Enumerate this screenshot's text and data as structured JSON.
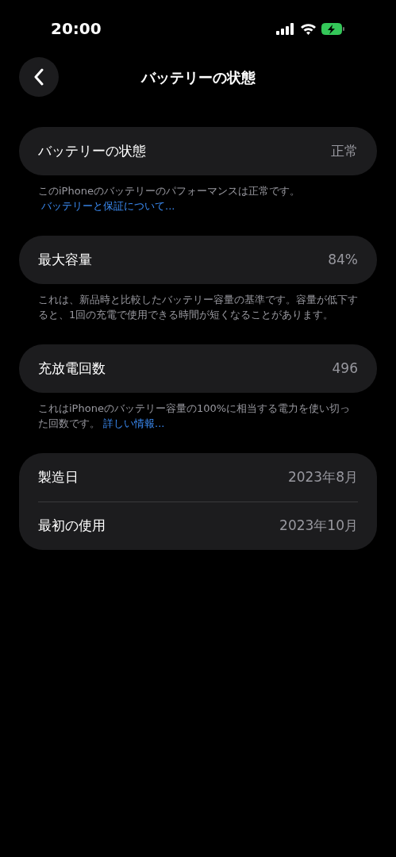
{
  "status_bar": {
    "time": "20:00"
  },
  "nav": {
    "title": "バッテリーの状態"
  },
  "groups": [
    {
      "rows": [
        {
          "label": "バッテリーの状態",
          "value": "正常"
        }
      ],
      "footnote": {
        "text": "このiPhoneのバッテリーのパフォーマンスは正常です。",
        "link": "バッテリーと保証について..."
      }
    },
    {
      "rows": [
        {
          "label": "最大容量",
          "value": "84%"
        }
      ],
      "footnote": {
        "text": "これは、新品時と比較したバッテリー容量の基準です。容量が低下すると、1回の充電で使用できる時間が短くなることがあります。"
      }
    },
    {
      "rows": [
        {
          "label": "充放電回数",
          "value": "496"
        }
      ],
      "footnote": {
        "text": "これはiPhoneのバッテリー容量の100%に相当する電力を使い切った回数です。",
        "link": "詳しい情報..."
      }
    },
    {
      "rows": [
        {
          "label": "製造日",
          "value": "2023年8月"
        },
        {
          "label": "最初の使用",
          "value": "2023年10月"
        }
      ]
    }
  ]
}
